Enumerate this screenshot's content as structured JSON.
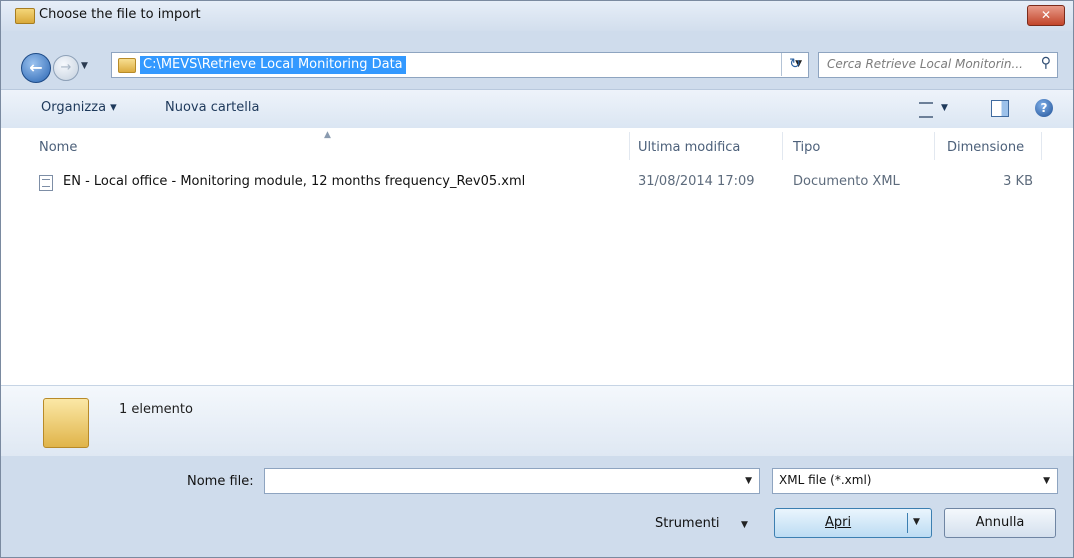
{
  "window": {
    "title": "Choose the file to import",
    "close_label": "✕"
  },
  "address": {
    "path": "C:\\MEVS\\Retrieve Local Monitoring Data"
  },
  "search": {
    "placeholder": "Cerca Retrieve Local Monitorin..."
  },
  "toolbar": {
    "organize_label": "Organizza ▾",
    "new_folder_label": "Nuova cartella"
  },
  "columns": {
    "name": "Nome",
    "modified": "Ultima modifica",
    "type": "Tipo",
    "size": "Dimensione"
  },
  "files": [
    {
      "name": "EN - Local office - Monitoring module, 12 months frequency_Rev05.xml",
      "modified": "31/08/2014 17:09",
      "type": "Documento XML",
      "size": "3 KB"
    }
  ],
  "details": {
    "count": "1 elemento"
  },
  "bottom": {
    "filename_label": "Nome file:",
    "filename_value": "",
    "filter_value": "XML file (*.xml)",
    "tools_label": "Strumenti",
    "open_label": "Apri",
    "cancel_label": "Annulla"
  }
}
